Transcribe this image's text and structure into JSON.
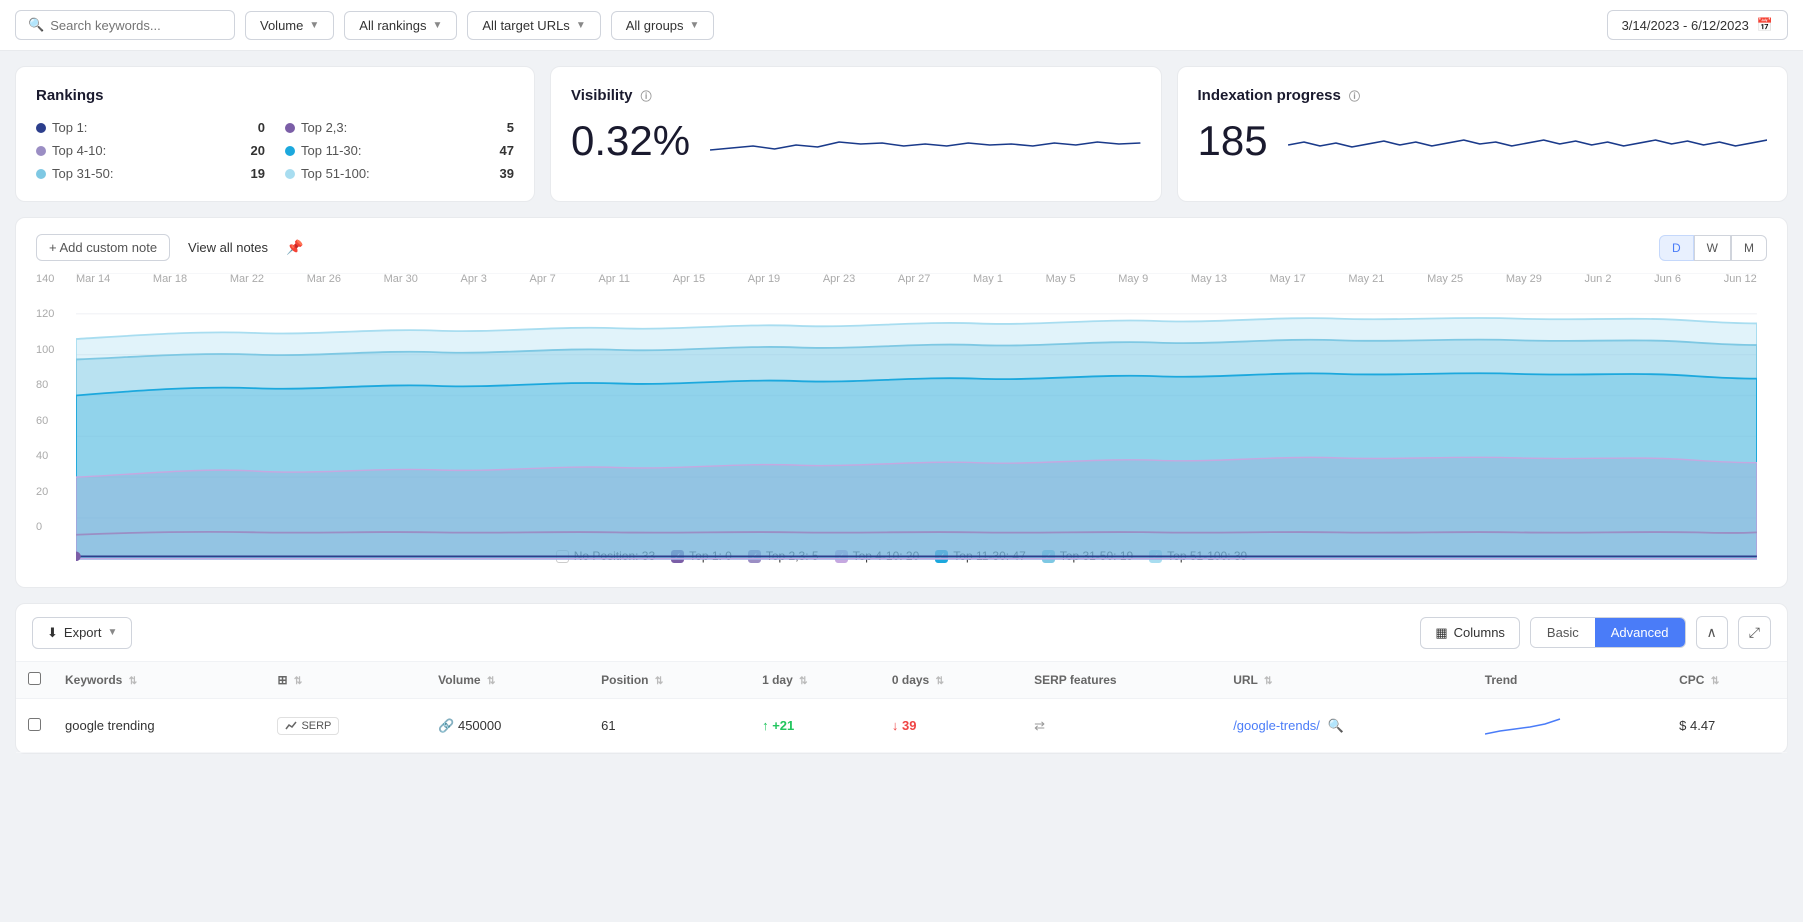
{
  "topbar": {
    "search_placeholder": "Search keywords...",
    "filters": [
      {
        "label": "Volume",
        "id": "volume-filter"
      },
      {
        "label": "All rankings",
        "id": "rankings-filter"
      },
      {
        "label": "All target URLs",
        "id": "urls-filter"
      },
      {
        "label": "All groups",
        "id": "groups-filter"
      }
    ],
    "date_range": "3/14/2023 - 6/12/2023"
  },
  "rankings": {
    "title": "Rankings",
    "items": [
      {
        "label": "Top 1:",
        "value": "0",
        "dot_class": "dot-dark-blue"
      },
      {
        "label": "Top 2,3:",
        "value": "5",
        "dot_class": "dot-purple"
      },
      {
        "label": "Top 4-10:",
        "value": "20",
        "dot_class": "dot-light-purple"
      },
      {
        "label": "Top 11-30:",
        "value": "47",
        "dot_class": "dot-medium-blue"
      },
      {
        "label": "Top 31-50:",
        "value": "19",
        "dot_class": "dot-light-blue"
      },
      {
        "label": "Top 51-100:",
        "value": "39",
        "dot_class": "dot-pale-blue"
      }
    ]
  },
  "visibility": {
    "title": "Visibility",
    "value": "0.32%"
  },
  "indexation": {
    "title": "Indexation progress",
    "value": "185"
  },
  "chart_toolbar": {
    "add_note_label": "+ Add custom note",
    "view_notes_label": "View all notes",
    "periods": [
      {
        "label": "D",
        "active": true
      },
      {
        "label": "W",
        "active": false
      },
      {
        "label": "M",
        "active": false
      }
    ]
  },
  "chart": {
    "y_labels": [
      "140",
      "120",
      "100",
      "80",
      "60",
      "40",
      "20",
      "0"
    ],
    "x_labels": [
      "Mar 14",
      "Mar 18",
      "Mar 22",
      "Mar 26",
      "Mar 30",
      "Apr 3",
      "Apr 7",
      "Apr 11",
      "Apr 15",
      "Apr 19",
      "Apr 23",
      "Apr 27",
      "May 1",
      "May 5",
      "May 9",
      "May 13",
      "May 17",
      "May 21",
      "May 25",
      "May 29",
      "Jun 2",
      "Jun 6",
      "Jun 12"
    ]
  },
  "legend": [
    {
      "label": "No Position: 33",
      "checked": false,
      "color": "none"
    },
    {
      "label": "Top 1: 0",
      "checked": true,
      "color": "#7b5ea7"
    },
    {
      "label": "Top 2,3: 5",
      "checked": true,
      "color": "#9b8ec4"
    },
    {
      "label": "Top 4-10: 20",
      "checked": true,
      "color": "#c5a8e0"
    },
    {
      "label": "Top 11-30: 47",
      "checked": true,
      "color": "#1ca8dd"
    },
    {
      "label": "Top 31-50: 19",
      "checked": true,
      "color": "#7ec8e3"
    },
    {
      "label": "Top 51-100: 39",
      "checked": true,
      "color": "#a8ddf0"
    }
  ],
  "table": {
    "export_label": "Export",
    "columns_label": "Columns",
    "view_basic": "Basic",
    "view_advanced": "Advanced",
    "headers": [
      {
        "label": "Keywords",
        "sortable": true
      },
      {
        "label": "",
        "sortable": false
      },
      {
        "label": "Volume",
        "sortable": true
      },
      {
        "label": "Position",
        "sortable": true
      },
      {
        "label": "1 day",
        "sortable": true
      },
      {
        "label": "0 days",
        "sortable": true
      },
      {
        "label": "SERP features",
        "sortable": false
      },
      {
        "label": "URL",
        "sortable": true
      },
      {
        "label": "Trend",
        "sortable": false
      },
      {
        "label": "CPC",
        "sortable": true
      }
    ],
    "rows": [
      {
        "keyword": "google trending",
        "serp": "SERP",
        "has_link": true,
        "volume": "450000",
        "position": "61",
        "day1_change": "+21",
        "day1_up": true,
        "days0_change": "39",
        "days0_down": true,
        "serp_features": "⇄",
        "url": "/google-trends/",
        "cpc": "$ 4.47"
      }
    ]
  }
}
